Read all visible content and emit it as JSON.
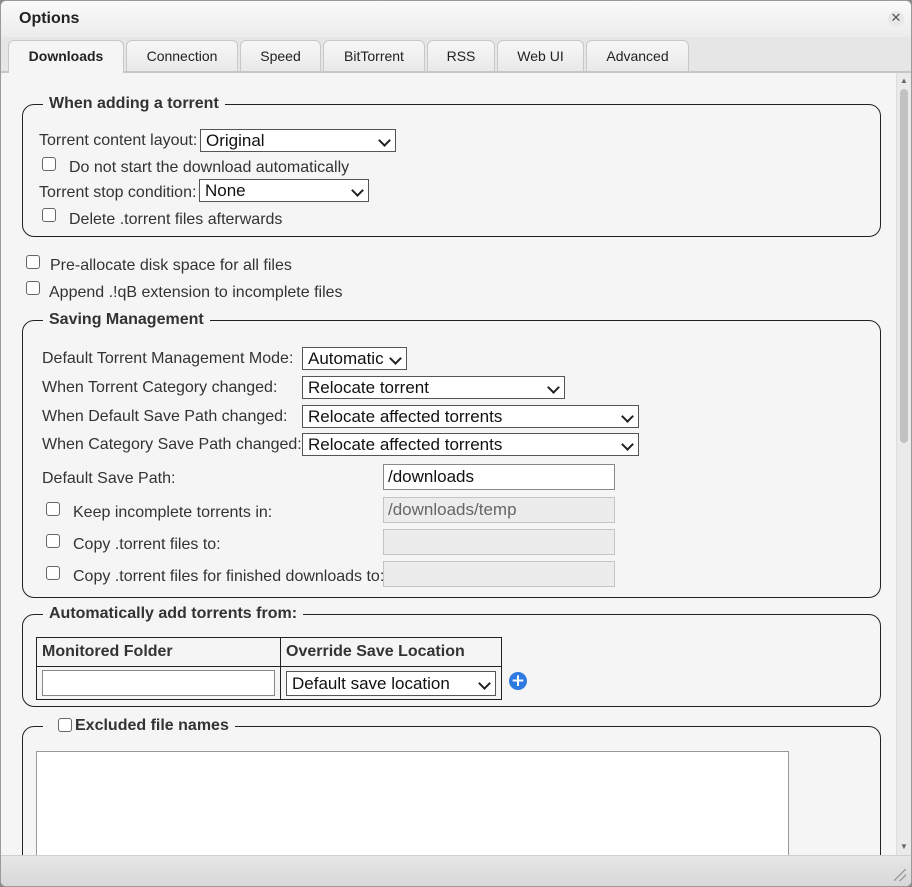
{
  "window": {
    "title": "Options"
  },
  "tabs": [
    {
      "label": "Downloads",
      "active": true
    },
    {
      "label": "Connection"
    },
    {
      "label": "Speed"
    },
    {
      "label": "BitTorrent"
    },
    {
      "label": "RSS"
    },
    {
      "label": "Web UI"
    },
    {
      "label": "Advanced"
    }
  ],
  "adding": {
    "legend": "When adding a torrent",
    "layout_label": "Torrent content layout:",
    "layout_value": "Original",
    "no_autostart_label": "Do not start the download automatically",
    "stop_condition_label": "Torrent stop condition:",
    "stop_condition_value": "None",
    "delete_torrent_label": "Delete .torrent files afterwards"
  },
  "preallocate_label": "Pre-allocate disk space for all files",
  "append_ext_label": "Append .!qB extension to incomplete files",
  "saving": {
    "legend": "Saving Management",
    "mode_label": "Default Torrent Management Mode:",
    "mode_value": "Automatic",
    "category_changed_label": "When Torrent Category changed:",
    "category_changed_value": "Relocate torrent",
    "default_path_changed_label": "When Default Save Path changed:",
    "default_path_changed_value": "Relocate affected torrents",
    "category_path_changed_label": "When Category Save Path changed:",
    "category_path_changed_value": "Relocate affected torrents",
    "save_path_label": "Default Save Path:",
    "save_path_value": "/downloads",
    "incomplete_label": "Keep incomplete torrents in:",
    "incomplete_value": "/downloads/temp",
    "copy_torrent_label": "Copy .torrent files to:",
    "copy_torrent_value": "",
    "copy_finished_label": "Copy .torrent files for finished downloads to:",
    "copy_finished_value": ""
  },
  "autoadd": {
    "legend": "Automatically add torrents from:",
    "col_folder": "Monitored Folder",
    "col_location": "Override Save Location",
    "folder_value": "",
    "location_value": "Default save location"
  },
  "excluded": {
    "legend": "Excluded file names",
    "value": ""
  }
}
